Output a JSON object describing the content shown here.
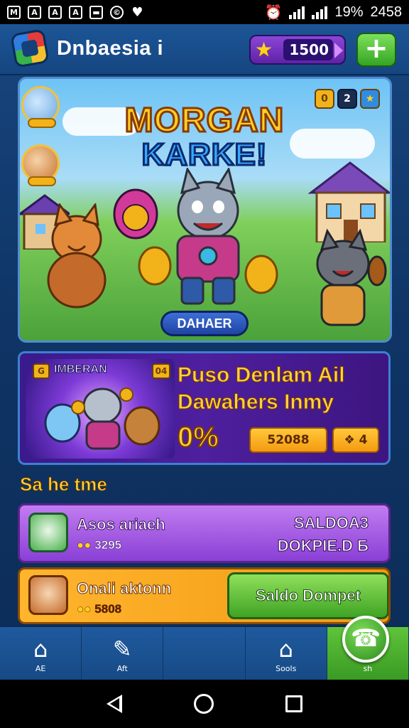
{
  "status_bar": {
    "left_icons": [
      "M",
      "A",
      "A",
      "A",
      "▬",
      "©",
      "♥"
    ],
    "battery": "19%",
    "time": "2458"
  },
  "header": {
    "title": "Dnbaesia i",
    "currency_value": "1500",
    "add_label": "+"
  },
  "hero": {
    "title_line1": "MORGAN",
    "title_line2": "KARKE!",
    "cta_label": "DAHAER",
    "badges": [
      "0",
      "2",
      "★"
    ]
  },
  "promo": {
    "art_title": "IMBERAN",
    "art_badge_left": "G",
    "art_badge_right": "04",
    "line1": "Puso Denlam Ail",
    "line2": "Dawahers Inmy",
    "percent": "0%",
    "button_value": "52088",
    "button2_value": "4"
  },
  "section": {
    "title": "Sa he tme"
  },
  "rows": [
    {
      "name": "Asos ariaeh",
      "coins": "3295",
      "right_line1": "SALDOA3",
      "right_line2": "DOKPIE.D Б"
    },
    {
      "name": "Onali aktonn",
      "coins": "5808",
      "button_label": "Saldo Dompet"
    }
  ],
  "bottom_nav": [
    {
      "label": "AE",
      "icon": "home-icon"
    },
    {
      "label": "Aft",
      "icon": "chart-icon"
    },
    {
      "label": "",
      "icon": "spacer"
    },
    {
      "label": "Sools",
      "icon": "store-icon"
    },
    {
      "label": "sh",
      "icon": "wallet-icon"
    }
  ],
  "colors": {
    "accent_yellow": "#ffd23a",
    "primary_blue": "#17457e",
    "green": "#3fa424",
    "purple": "#8a3fd6"
  }
}
